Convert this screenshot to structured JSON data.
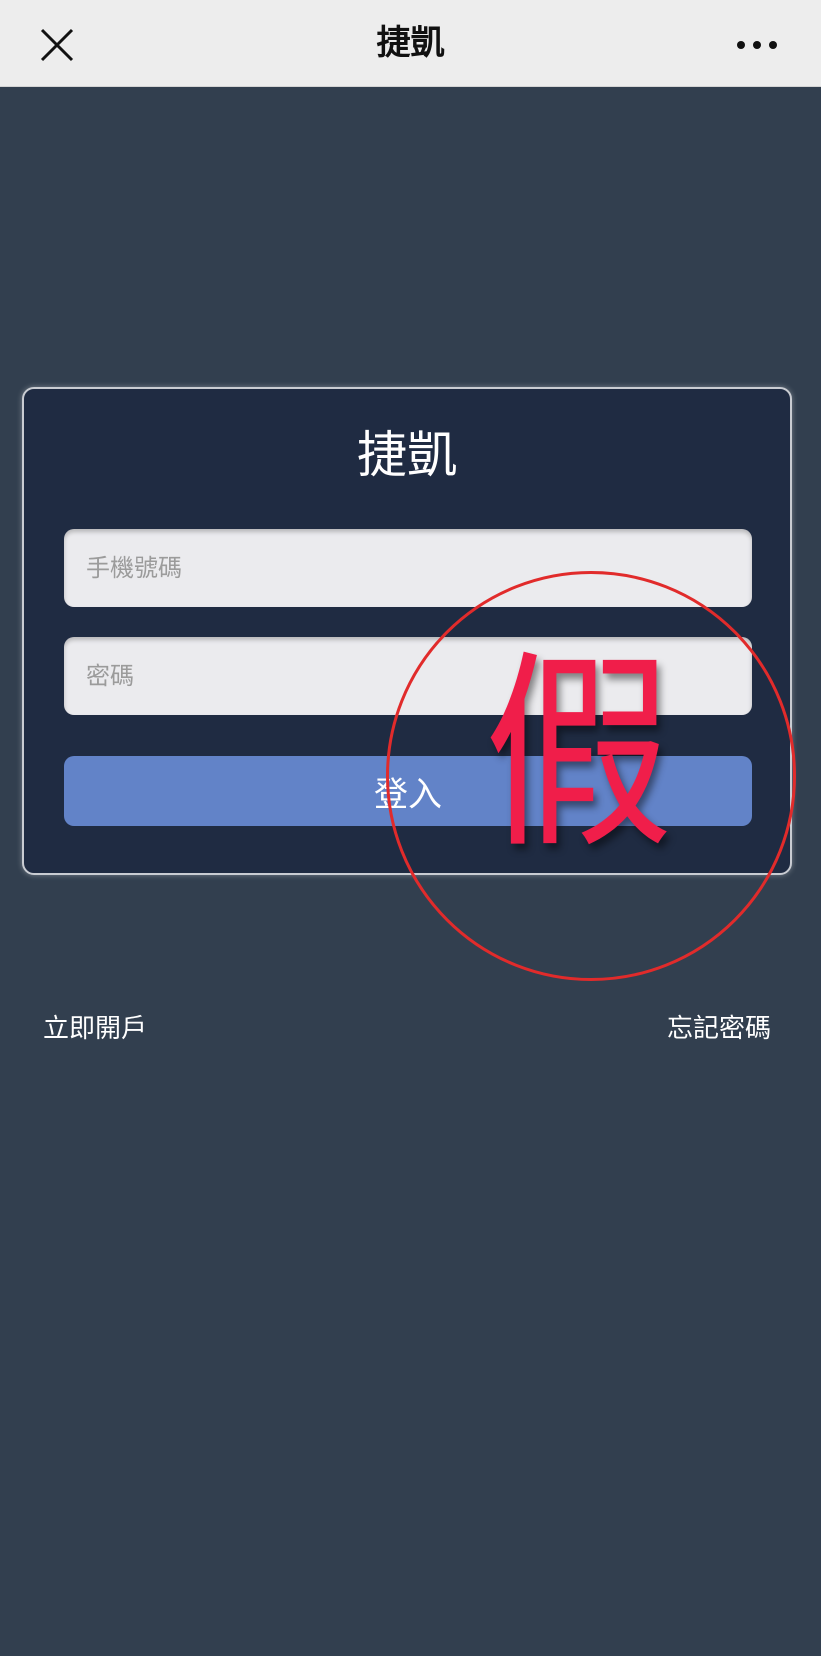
{
  "header": {
    "title": "捷凱",
    "close_icon": "close-icon",
    "more_icon": "more-dots-icon"
  },
  "login_card": {
    "title": "捷凱",
    "phone_placeholder": "手機號碼",
    "password_placeholder": "密碼",
    "login_label": "登入"
  },
  "links": {
    "register": "立即開戶",
    "forgot_password": "忘記密碼"
  },
  "overlay_stamp": {
    "text": "假",
    "color": "#f01e4a"
  },
  "colors": {
    "header_bg": "#ededed",
    "page_bg": "#323f4f",
    "card_bg": "#1f2b42",
    "button_bg": "#6283c8"
  }
}
